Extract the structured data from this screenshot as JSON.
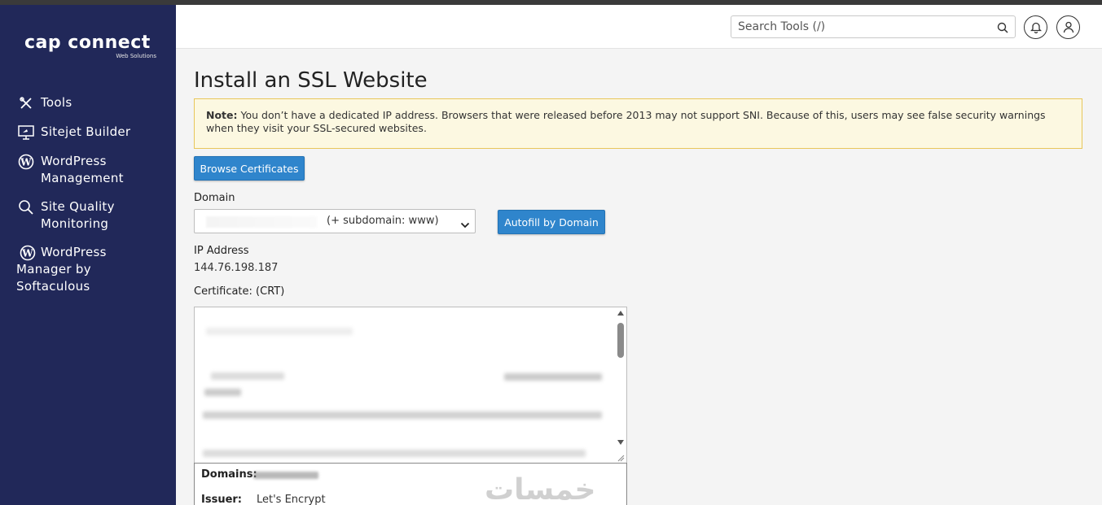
{
  "brand": {
    "name": "cap connect",
    "tagline": "Web Solutions"
  },
  "sidebar": {
    "items": [
      {
        "label": "Tools",
        "icon": "tools-icon"
      },
      {
        "label": "Sitejet Builder",
        "icon": "sitejet-icon"
      },
      {
        "label": "WordPress Management",
        "icon": "wordpress-icon"
      },
      {
        "label": "Site Quality Monitoring",
        "icon": "magnifier-icon"
      },
      {
        "label": "WordPress Manager by Softaculous",
        "icon": "wordpress-icon"
      }
    ]
  },
  "header": {
    "search_placeholder": "Search Tools (/)",
    "bell_icon": "bell-icon",
    "user_icon": "user-icon"
  },
  "page": {
    "title": "Install an SSL Website",
    "note_label": "Note:",
    "note_text": " You don’t have a dedicated IP address. Browsers that were released before 2013 may not support SNI. Because of this, users may see false security warnings when they visit your SSL-secured websites.",
    "browse_button": "Browse Certificates",
    "domain_label": "Domain",
    "domain_select_text": "(+ subdomain: www)",
    "autofill_button": "Autofill by Domain",
    "ip_label": "IP Address",
    "ip_value": "144.76.198.187",
    "cert_label": "Certificate: (CRT)",
    "domains_label": "Domains:",
    "issuer_label": "Issuer:",
    "issuer_value": "Let's Encrypt",
    "watermark": "خمسات"
  },
  "colors": {
    "sidebar_bg": "#212859",
    "accent_button": "#2f85cc",
    "note_bg": "#fcf8e1",
    "note_border": "#e8c65a"
  }
}
